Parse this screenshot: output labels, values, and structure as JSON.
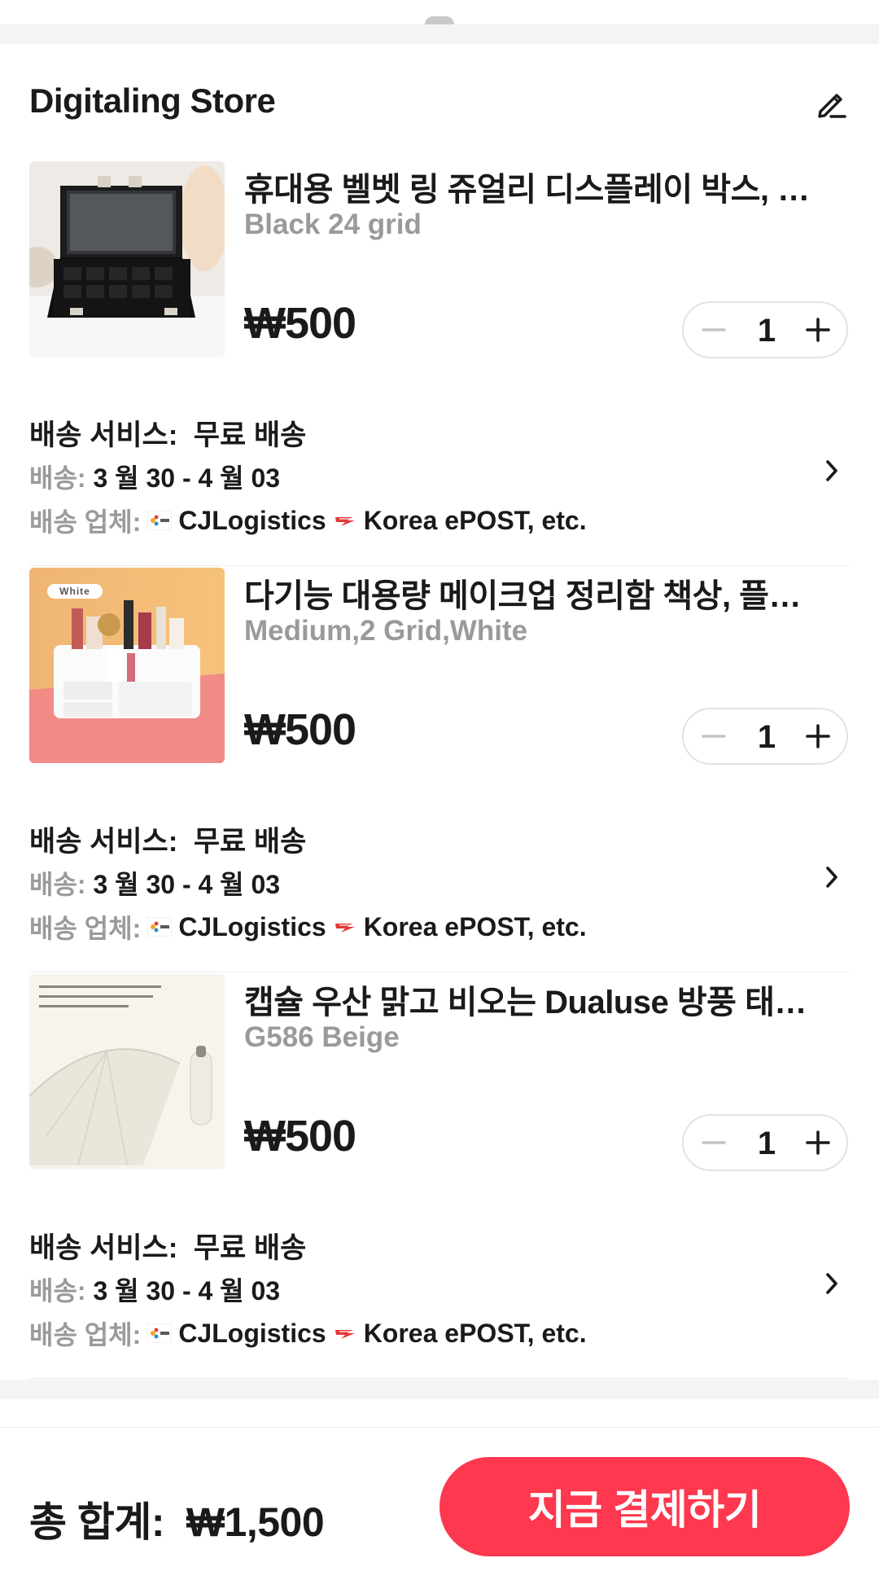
{
  "store": {
    "name": "Digitaling Store"
  },
  "items": [
    {
      "title": "휴대용 벨벳 링 쥬얼리 디스플레이 박스, 트...",
      "variant": "Black 24 grid",
      "price": "₩500",
      "quantity": "1",
      "shipping_service_label": "배송 서비스:",
      "shipping_service_value": "무료 배송",
      "delivery_label": "배송:",
      "delivery_value": "3 월 30 - 4 월 03",
      "carrier_label": "배송 업체:",
      "carrier1": "CJLogistics",
      "carrier2": "Korea ePOST, etc."
    },
    {
      "title": "다기능 대용량 메이크업 정리함 책상, 플라스...",
      "variant": "Medium,2 Grid,White",
      "price": "₩500",
      "quantity": "1",
      "image_tag": "White",
      "shipping_service_label": "배송 서비스:",
      "shipping_service_value": "무료 배송",
      "delivery_label": "배송:",
      "delivery_value": "3 월 30 - 4 월 03",
      "carrier_label": "배송 업체:",
      "carrier1": "CJLogistics",
      "carrier2": "Korea ePOST, etc."
    },
    {
      "title": "캡슐 우산 맑고 비오는 Dualuse 방풍 태양 ...",
      "variant": "G586 Beige",
      "price": "₩500",
      "quantity": "1",
      "shipping_service_label": "배송 서비스:",
      "shipping_service_value": "무료 배송",
      "delivery_label": "배송:",
      "delivery_value": "3 월 30 - 4 월 03",
      "carrier_label": "배송 업체:",
      "carrier1": "CJLogistics",
      "carrier2": "Korea ePOST, etc."
    }
  ],
  "footer": {
    "total_label": "총 합계:",
    "total_value": "₩1,500",
    "pay_button": "지금 결제하기"
  },
  "colors": {
    "accent": "#fd384f",
    "muted_text": "#9a9a9a",
    "section_gap": "#f4f4f4"
  },
  "icons": [
    "edit-pencil-icon",
    "minus-icon",
    "plus-icon",
    "chevron-right-icon",
    "cj-logistics-logo-icon",
    "korea-epost-logo-icon"
  ]
}
